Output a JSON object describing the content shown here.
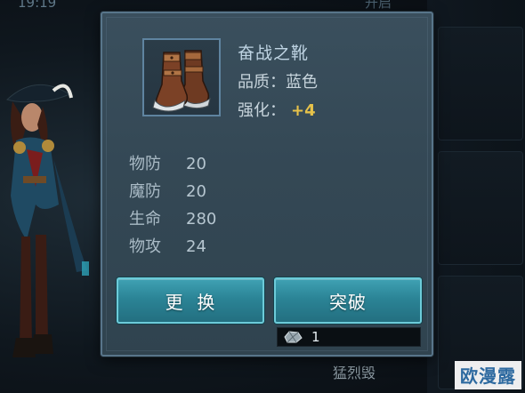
{
  "background": {
    "top_left_text": "19:19",
    "top_right_text": "开启",
    "bottom_text": "猛烈毁",
    "watermark": "欧漫露"
  },
  "item": {
    "icon": "leather-boots-icon",
    "name": "奋战之靴",
    "quality_label": "品质：",
    "quality_value": "蓝色",
    "enhance_label": "强化：",
    "enhance_value": "+4"
  },
  "stats": [
    {
      "label": "物防",
      "value": "20"
    },
    {
      "label": "魔防",
      "value": "20"
    },
    {
      "label": "生命",
      "value": "280"
    },
    {
      "label": "物攻",
      "value": "24"
    }
  ],
  "buttons": {
    "replace_label": "更  换",
    "breakthrough_label": "突破"
  },
  "cost": {
    "icon": "material-stone-icon",
    "amount": "1"
  },
  "colors": {
    "enhance_accent": "#e6c24a",
    "button_teal": "#2b8496",
    "panel_bg": "#344855"
  }
}
